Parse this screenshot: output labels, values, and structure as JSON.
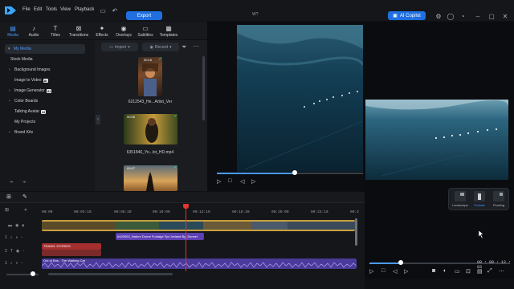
{
  "app": {
    "project_title": "W?",
    "menu": [
      "File",
      "Edit",
      "Tools",
      "View",
      "Playback"
    ],
    "export_label": "Export",
    "ai_copilot_label": "AI Copilot"
  },
  "media_tabs": [
    {
      "label": "Media",
      "icon": "media-icon"
    },
    {
      "label": "Audio",
      "icon": "audio-icon"
    },
    {
      "label": "Titles",
      "icon": "titles-icon"
    },
    {
      "label": "Transitions",
      "icon": "transitions-icon"
    },
    {
      "label": "Effects",
      "icon": "effects-icon"
    },
    {
      "label": "Overlays",
      "icon": "overlays-icon"
    },
    {
      "label": "Subtitles",
      "icon": "subtitles-icon"
    },
    {
      "label": "Templates",
      "icon": "templates-icon"
    }
  ],
  "sidebar": {
    "items": [
      {
        "label": "My Media",
        "chev": "▾",
        "ai": ""
      },
      {
        "label": "Stock Media",
        "chev": "",
        "ai": ""
      },
      {
        "label": "Background Images",
        "chev": "›",
        "ai": ""
      },
      {
        "label": "Image to Video",
        "chev": "",
        "ai": "AI"
      },
      {
        "label": "Image Generator",
        "chev": "›",
        "ai": "AI"
      },
      {
        "label": "Color Boards",
        "chev": "›",
        "ai": ""
      },
      {
        "label": "Talking Avatar",
        "chev": "",
        "ai": "AI"
      },
      {
        "label": "My Projects",
        "chev": "",
        "ai": ""
      },
      {
        "label": "Brand Kits",
        "chev": "›",
        "ai": ""
      }
    ]
  },
  "media_toolbar": {
    "import_label": "Import",
    "record_label": "Record"
  },
  "media_items": [
    {
      "name": "6212543_He...Artist_Ver",
      "duration": "00:16"
    },
    {
      "name": "6351846_Yo...lot_HD.mp4",
      "duration": "00:06"
    },
    {
      "name": "",
      "duration": "00:07"
    }
  ],
  "preview2": {
    "time": "00 : 00 : 12 : 03"
  },
  "layout_popup": {
    "options": [
      "Landscape",
      "Portrait",
      "Floating"
    ],
    "selected": "Portrait"
  },
  "timeline": {
    "ticks": [
      "00:00",
      "00:03:10",
      "00:06:20",
      "00:10:00",
      "00:13:10",
      "00:16:20",
      "00:20:00",
      "00:23:10",
      "00:2"
    ],
    "track_labels": [
      "",
      "1",
      "2",
      "1",
      "1"
    ],
    "clips": {
      "audio_clip": "6420903_Nature Drone Footage Fpv Iceland By_Sunset",
      "text_clip": "TRAVEL STORIES",
      "music_clip": "Out of Bus - The Walking Cat"
    }
  },
  "colors": {
    "accent": "#1f6fe0",
    "playhead": "#e0362c",
    "audio_clip": "#5b3fb3",
    "text_clip": "#a52f2f"
  }
}
